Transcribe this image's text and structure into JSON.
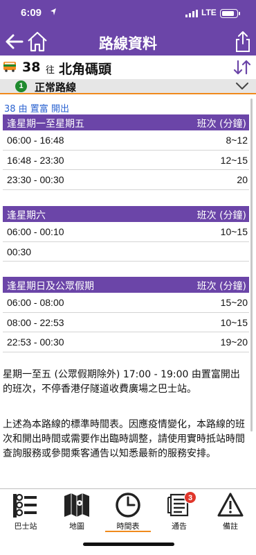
{
  "status": {
    "time": "6:09",
    "network": "LTE"
  },
  "nav": {
    "title": "路線資料"
  },
  "route": {
    "number": "38",
    "towards": "往",
    "destination": "北角碼頭"
  },
  "variant": {
    "index": "1",
    "label": "正常路線"
  },
  "departure": "38 由 置富 開出",
  "timetable": [
    {
      "name": "逢星期一至星期五",
      "freq_header": "班次 (分鐘)",
      "rows": [
        {
          "period": "06:00 - 16:48",
          "freq": "8~12"
        },
        {
          "period": "16:48 - 23:30",
          "freq": "12~15"
        },
        {
          "period": "23:30 - 00:30",
          "freq": "20"
        }
      ]
    },
    {
      "name": "逢星期六",
      "freq_header": "班次 (分鐘)",
      "rows": [
        {
          "period": "06:00 - 00:10",
          "freq": "10~15"
        },
        {
          "period": "00:30",
          "freq": ""
        }
      ]
    },
    {
      "name": "逢星期日及公眾假期",
      "freq_header": "班次 (分鐘)",
      "rows": [
        {
          "period": "06:00 - 08:00",
          "freq": "15~20"
        },
        {
          "period": "08:00 - 22:53",
          "freq": "10~15"
        },
        {
          "period": "22:53 - 00:30",
          "freq": "19~20"
        }
      ]
    }
  ],
  "notes": [
    "星期一至五 (公眾假期除外) 17:00 - 19:00 由置富開出的班次，不停香港仔隧道收費廣場之巴士站。",
    "上述為本路線的標準時間表。因應疫情變化，本路線的班次和開出時間或需要作出臨時調整，請使用實時抵站時間查詢服務或參閱乘客通告以知悉最新的服務安排。"
  ],
  "tabs": [
    {
      "label": "巴士站",
      "icon": "bus-stop-icon"
    },
    {
      "label": "地圖",
      "icon": "map-icon"
    },
    {
      "label": "時間表",
      "icon": "clock-icon",
      "active": true
    },
    {
      "label": "通告",
      "icon": "notice-icon",
      "badge": "3"
    },
    {
      "label": "備註",
      "icon": "warning-icon"
    }
  ],
  "colors": {
    "primary": "#6b45a8",
    "accent": "#f08a1c",
    "badge": "#e0362b",
    "link": "#2a62d0"
  }
}
